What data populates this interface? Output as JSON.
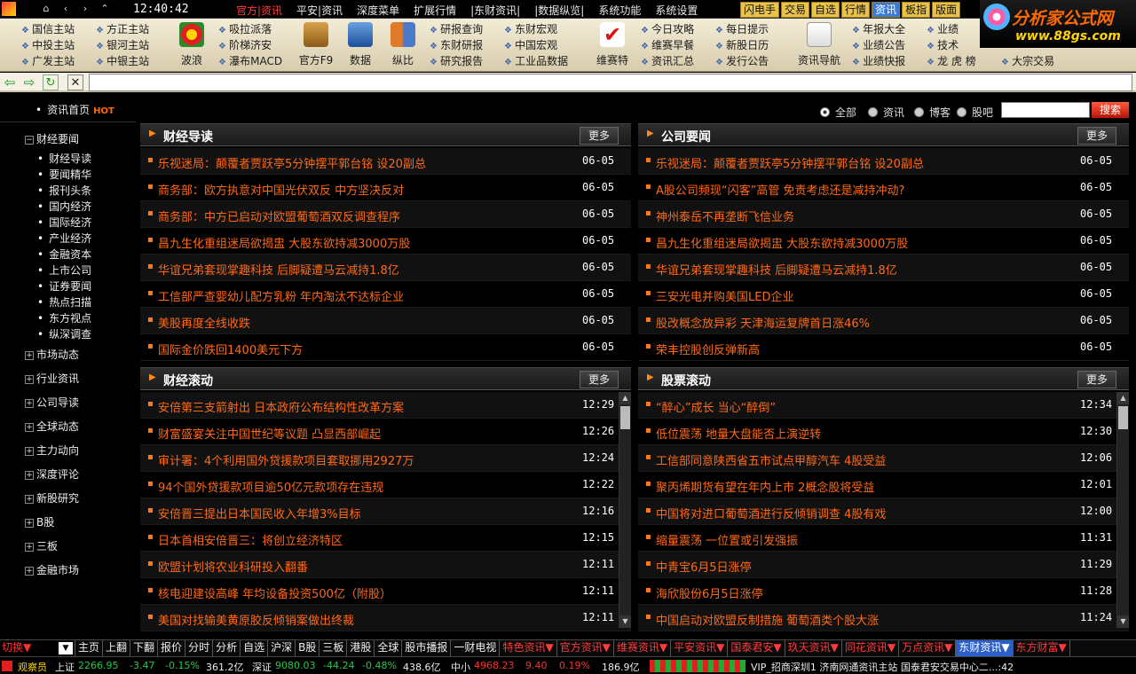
{
  "menubar": {
    "clock": "12:40:42",
    "menus": [
      "官方|资讯",
      "平安|资讯",
      "深度菜单",
      "扩展行情",
      "|东财资讯|",
      "|数据纵览|",
      "系统功能",
      "系统设置"
    ],
    "quick": [
      "闪电手",
      "交易",
      "自选",
      "行情",
      "资讯",
      "板指",
      "版面"
    ],
    "quick_selected": "资讯",
    "logo_text": "分析家公式网",
    "logo_url": "www.88gs.com"
  },
  "toolbar": {
    "col1": [
      "国信主站",
      "中投主站",
      "广发主站"
    ],
    "col2": [
      "方正主站",
      "银河主站",
      "中银主站"
    ],
    "big1": "波浪",
    "col3": [
      "吸拉派落",
      "阶梯济安",
      "瀑布MACD"
    ],
    "big2": "官方F9",
    "big3": "数据",
    "big4": "纵比",
    "col4": [
      "研报查询",
      "东财研报",
      "研究报告"
    ],
    "col5": [
      "东财宏观",
      "中国宏观",
      "工业品数据"
    ],
    "big5": "维赛特",
    "col6": [
      "今日攻略",
      "维赛早餐",
      "资讯汇总"
    ],
    "col7": [
      "每日提示",
      "新股日历",
      "发行公告"
    ],
    "big6": "资讯导航",
    "col8": [
      "年报大全",
      "业绩公告",
      "业绩快报"
    ],
    "col9": [
      "业绩",
      "技术",
      "龙 虎 榜"
    ],
    "col10": [
      "大宗交易"
    ]
  },
  "sidebar": {
    "home": "资讯首页",
    "hot": "HOT",
    "caijing": "财经要闻",
    "sub": [
      "财经导读",
      "要闻精华",
      "报刊头条",
      "国内经济",
      "国际经济",
      "产业经济",
      "金融资本",
      "上市公司",
      "证券要闻",
      "热点扫描",
      "东方视点",
      "纵深调查"
    ],
    "groups": [
      "市场动态",
      "行业资讯",
      "公司导读",
      "全球动态",
      "主力动向",
      "深度评论",
      "新股研究",
      "B股",
      "三板",
      "金融市场"
    ]
  },
  "search": {
    "options": [
      "全部",
      "资讯",
      "博客",
      "股吧"
    ],
    "selected": "全部",
    "button": "搜索",
    "value": ""
  },
  "panels": {
    "more_label": "更多",
    "p1": {
      "title": "财经导读",
      "items": [
        {
          "t": "乐视迷局：颠覆者贾跃亭5分钟摆平郭台铭 设20副总",
          "d": "06-05"
        },
        {
          "t": "商务部：欧方执意对中国光伏双反 中方坚决反对",
          "d": "06-05"
        },
        {
          "t": "商务部：中方已启动对欧盟葡萄酒双反调查程序",
          "d": "06-05"
        },
        {
          "t": "昌九生化重组迷局欲揭盅 大股东欲持减3000万股",
          "d": "06-05"
        },
        {
          "t": "华谊兄弟套现掌趣科技 后脚疑遭马云减持1.8亿",
          "d": "06-05"
        },
        {
          "t": "工信部严查婴幼儿配方乳粉 年内淘汰不达标企业",
          "d": "06-05"
        },
        {
          "t": "美股再度全线收跌",
          "d": "06-05"
        },
        {
          "t": "国际金价跌回1400美元下方",
          "d": "06-05"
        }
      ]
    },
    "p2": {
      "title": "公司要闻",
      "items": [
        {
          "t": "乐视迷局：颠覆者贾跃亭5分钟摆平郭台铭 设20副总",
          "d": "06-05"
        },
        {
          "t": "A股公司频现“闪客”高管 免责考虑还是减持冲动?",
          "d": "06-05"
        },
        {
          "t": "神州泰岳不再垄断飞信业务",
          "d": "06-05"
        },
        {
          "t": "昌九生化重组迷局欲揭盅 大股东欲持减3000万股",
          "d": "06-05"
        },
        {
          "t": "华谊兄弟套现掌趣科技 后脚疑遭马云减持1.8亿",
          "d": "06-05"
        },
        {
          "t": "三安光电并购美国LED企业",
          "d": "06-05"
        },
        {
          "t": "股改概念放异彩 天津海运复牌首日涨46%",
          "d": "06-05"
        },
        {
          "t": "荣丰控股创反弹新高",
          "d": "06-05"
        }
      ]
    },
    "p3": {
      "title": "财经滚动",
      "items": [
        {
          "t": "安倍第三支箭射出 日本政府公布结构性改革方案",
          "d": "12:29"
        },
        {
          "t": "财富盛宴关注中国世纪等议题 凸显西部崛起",
          "d": "12:26"
        },
        {
          "t": "审计署：4个利用国外贷援款项目套取挪用2927万",
          "d": "12:24"
        },
        {
          "t": "94个国外贷援款项目逾50亿元款项存在违规",
          "d": "12:22"
        },
        {
          "t": "安倍晋三提出日本国民收入年增3%目标",
          "d": "12:16"
        },
        {
          "t": "日本首相安倍晋三：将创立经济特区",
          "d": "12:15"
        },
        {
          "t": "欧盟计划将农业科研投入翻番",
          "d": "12:11"
        },
        {
          "t": "核电迎建设高峰 年均设备投资500亿（附股）",
          "d": "12:11"
        },
        {
          "t": "美国对找输美黄原胶反倾销案做出终裁",
          "d": "12:11"
        }
      ]
    },
    "p4": {
      "title": "股票滚动",
      "items": [
        {
          "t": "“醉心”成长 当心“醉倒”",
          "d": "12:34"
        },
        {
          "t": "低位震荡 地量大盘能否上演逆转",
          "d": "12:30"
        },
        {
          "t": "工信部同意陕西省五市试点甲醇汽车 4股受益",
          "d": "12:06"
        },
        {
          "t": "聚丙烯期货有望在年内上市 2概念股将受益",
          "d": "12:01"
        },
        {
          "t": "中国将对进口葡萄酒进行反倾销调查 4股有戏",
          "d": "12:00"
        },
        {
          "t": "缩量震荡 一位置或引发强振",
          "d": "11:31"
        },
        {
          "t": "中青宝6月5日涨停",
          "d": "11:29"
        },
        {
          "t": "海欣股份6月5日涨停",
          "d": "11:28"
        },
        {
          "t": "中国启动对欧盟反制措施 葡萄酒类个股大涨",
          "d": "11:24"
        }
      ]
    }
  },
  "tabstrip": {
    "switch": "切换▼",
    "tabs": [
      "主页",
      "上翻",
      "下翻",
      "报价",
      "分时",
      "分析",
      "自选",
      "沪深",
      "B股",
      "三板",
      "港股",
      "全球",
      "股市播报",
      "一财电视"
    ],
    "colored": [
      "特色资讯▼",
      "官方资讯▼",
      "维赛资讯▼",
      "平安资讯▼",
      "国泰君安▼",
      "玖天资讯▼",
      "同花资讯▼",
      "万点资讯▼"
    ],
    "selected": "东财资讯▼",
    "last": "东方财富▼"
  },
  "statusbar": {
    "user": "观察员",
    "sh_name": "上证",
    "sh_val": "2266.95",
    "sh_chg": "-3.47",
    "sh_pct": "-0.15%",
    "sh_amt": "361.2亿",
    "sz_name": "深证",
    "sz_val": "9080.03",
    "sz_chg": "-44.24",
    "sz_pct": "-0.48%",
    "sz_amt": "438.6亿",
    "zx_name": "中小",
    "zx_val": "4968.23",
    "zx_chg": "9.40",
    "zx_pct": "0.19%",
    "zx_amt": "186.9亿",
    "ticker": "VIP_招商深圳1 济南网通资讯主站 国泰君安交易中心二...:42"
  }
}
